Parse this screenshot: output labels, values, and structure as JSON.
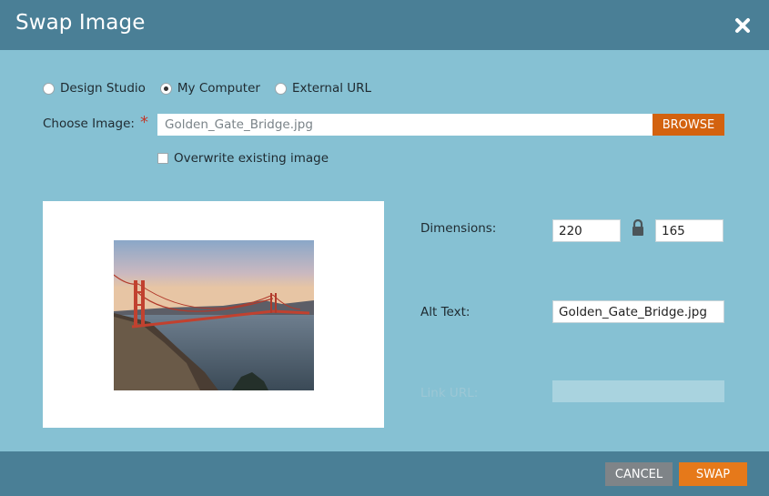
{
  "dialog": {
    "title": "Swap Image",
    "close_icon": "close-icon"
  },
  "source": {
    "options": [
      {
        "label": "Design Studio",
        "checked": false
      },
      {
        "label": "My Computer",
        "checked": true
      },
      {
        "label": "External URL",
        "checked": false
      }
    ]
  },
  "choose_image": {
    "label": "Choose Image:",
    "required_mark": "*",
    "value": "Golden_Gate_Bridge.jpg",
    "browse_label": "BROWSE"
  },
  "overwrite": {
    "label": "Overwrite existing image",
    "checked": false
  },
  "properties": {
    "dimensions_label": "Dimensions:",
    "width": "220",
    "height": "165",
    "lock_icon": "lock-icon",
    "alt_text_label": "Alt Text:",
    "alt_text_value": "Golden_Gate_Bridge.jpg",
    "link_url_label": "Link URL:",
    "link_url_value": ""
  },
  "footer": {
    "cancel_label": "CANCEL",
    "swap_label": "SWAP"
  },
  "colors": {
    "header": "#4a7f96",
    "body": "#86c1d3",
    "browse": "#d3620f",
    "swap": "#e6791a",
    "cancel": "#7f8488"
  }
}
